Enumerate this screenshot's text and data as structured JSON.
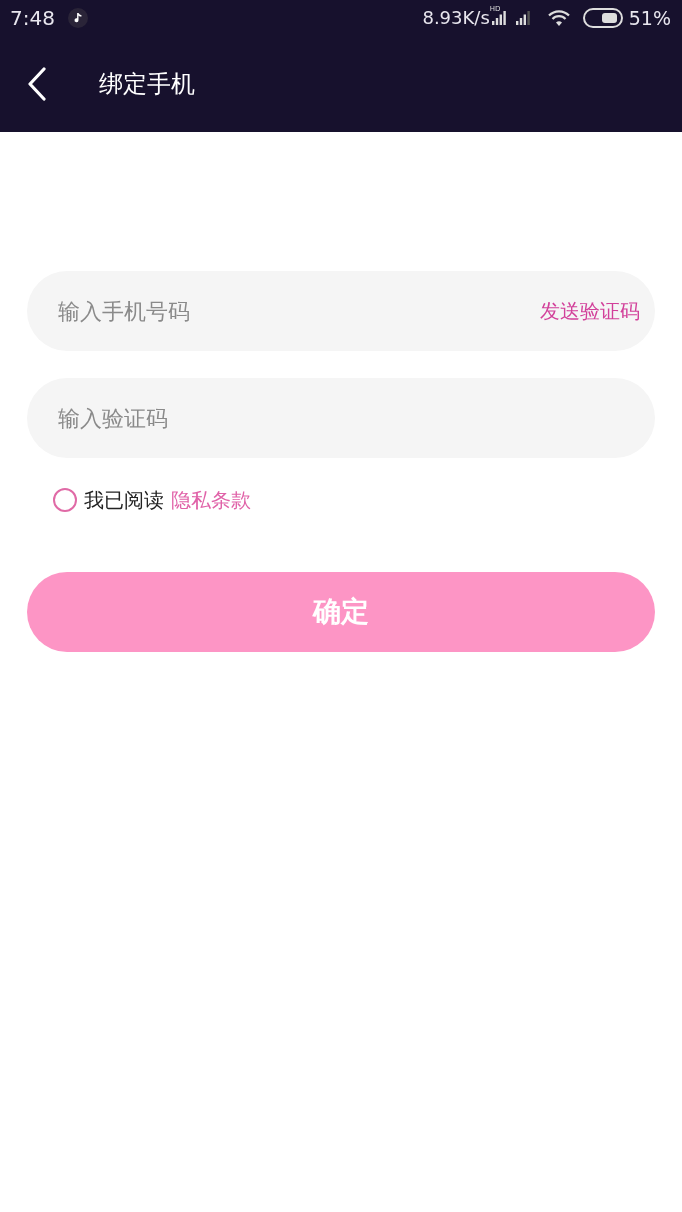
{
  "status_bar": {
    "time": "7:48",
    "network_speed": "8.93K/s",
    "signal_badge": "HD",
    "battery_text": "51%"
  },
  "header": {
    "title": "绑定手机"
  },
  "form": {
    "phone_field": {
      "placeholder": "输入手机号码"
    },
    "send_code_link": "发送验证码",
    "code_field": {
      "placeholder": "输入验证码"
    },
    "agreement": {
      "checked": false,
      "label": "我已阅读",
      "link": "隐私条款"
    },
    "confirm_button": {
      "label": "确定",
      "disabled": true
    }
  }
}
